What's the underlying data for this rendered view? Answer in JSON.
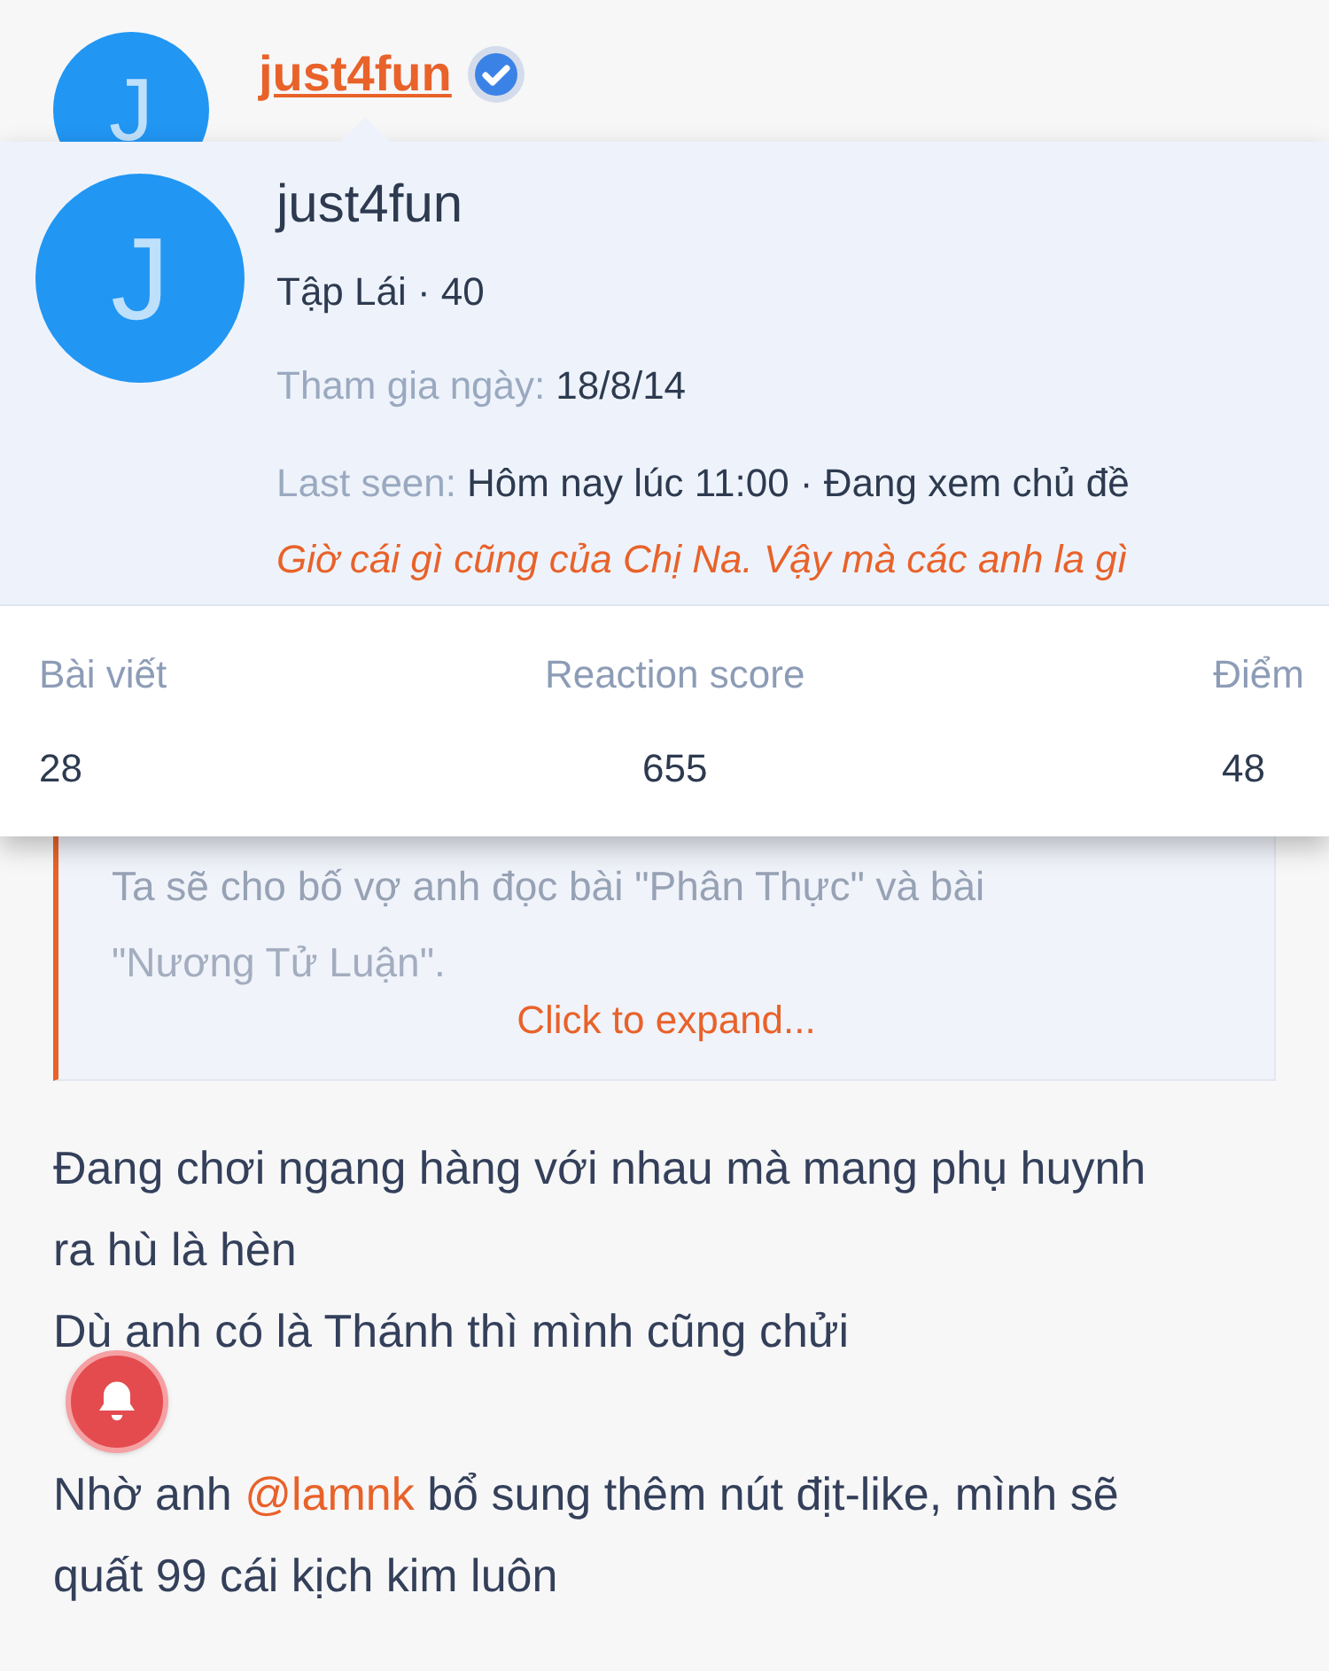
{
  "post_header": {
    "avatar_letter": "J",
    "username": "just4fun",
    "verified": true
  },
  "member_card": {
    "avatar_letter": "J",
    "name": "just4fun",
    "title": "Tập Lái · 40",
    "joined_label": "Tham gia ngày:",
    "joined_value": "18/8/14",
    "last_seen_label": "Last seen:",
    "last_seen_value": "Hôm nay lúc 11:00 · Đang xem chủ đề",
    "signature": "Giờ cái gì cũng của Chị Na. Vậy mà các anh la gì",
    "stats": [
      {
        "label": "Bài viết",
        "value": "28"
      },
      {
        "label": "Reaction score",
        "value": "655"
      },
      {
        "label": "Điểm",
        "value": "48"
      }
    ]
  },
  "quote": {
    "lines": [
      "Ta sẽ cho bố vợ anh đọc bài \"Phân Thực\" và bài",
      "\"Nương Tử Luận\"."
    ],
    "expand_link": "Click to expand..."
  },
  "post_body": [
    {
      "kind": "text",
      "text": "Đang chơi ngang hàng với nhau mà mang phụ huynh ra hù là hèn"
    },
    {
      "kind": "text",
      "text": "Dù anh có là Thánh thì mình cũng chửi"
    },
    {
      "kind": "gap"
    },
    {
      "kind": "mention",
      "before": "Nhờ anh",
      "mention": "@lamnk",
      "after": "bổ sung thêm nút địt-like, mình sẽ quất 99 cái kịch kim luôn"
    }
  ]
}
